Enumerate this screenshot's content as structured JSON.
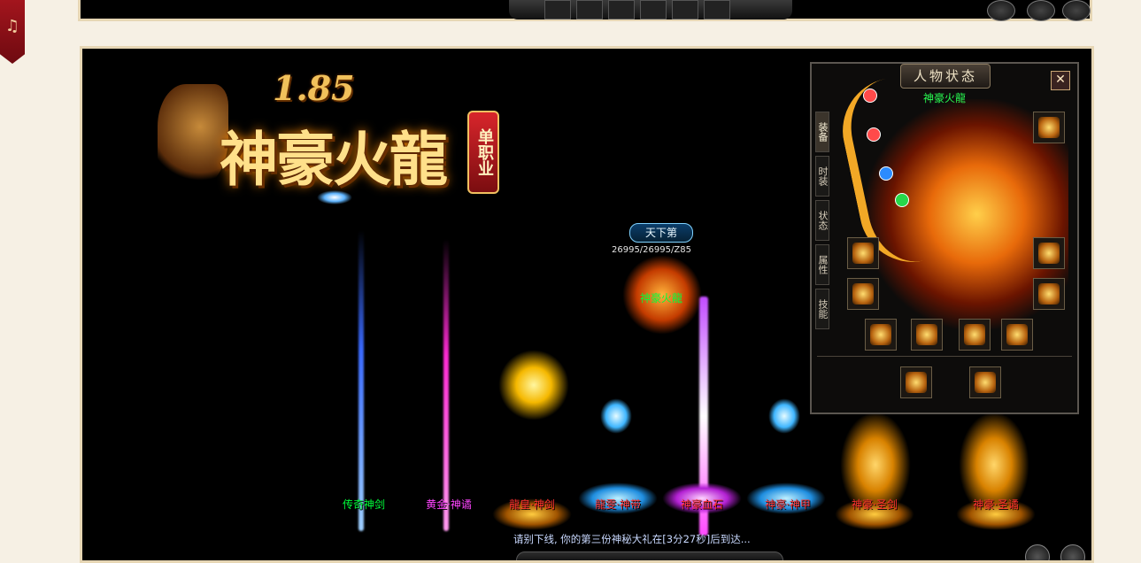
{
  "top": {
    "music_icon": "music-note-icon"
  },
  "logo": {
    "version": "1.85",
    "title": "神豪火龍",
    "badge": "单职业"
  },
  "character": {
    "title": "天下第",
    "hp": "26995/26995/Z85",
    "name": "神豪火龍"
  },
  "items": [
    {
      "label": "传奇神剑",
      "color": "#00ff3a"
    },
    {
      "label": "黄金·神谲",
      "color": "#ff44ff"
    },
    {
      "label": "龍皇·神剑",
      "color": "#ff3030"
    },
    {
      "label": "龍雯·神带",
      "color": "#ff3030"
    },
    {
      "label": "神豪血石",
      "color": "#ff3030"
    },
    {
      "label": "神豪·神甲",
      "color": "#ff3030"
    },
    {
      "label": "神豪·圣剑",
      "color": "#ff3030"
    },
    {
      "label": "神豪·圣谲",
      "color": "#ff3030"
    }
  ],
  "status_message": "请别下线, 你的第三份神秘大礼在[3分27秒]后到达...",
  "panel": {
    "title": "人物状态",
    "close": "✕",
    "player_name": "神豪火龍",
    "tabs": [
      "装备",
      "时装",
      "状态",
      "属性",
      "技能"
    ]
  }
}
